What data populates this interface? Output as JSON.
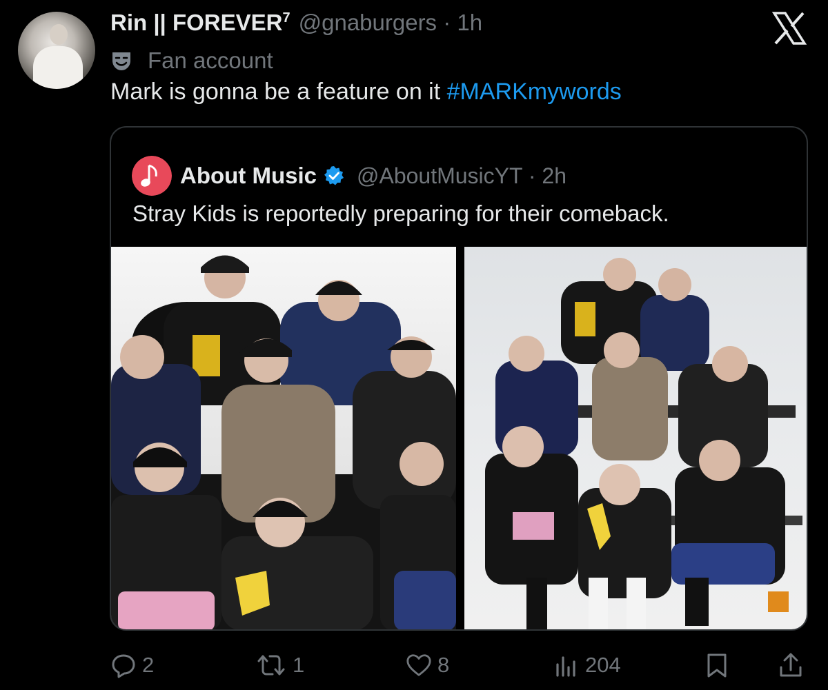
{
  "tweet": {
    "author_name": "Rin || FOREVER",
    "author_sup": "7",
    "handle": "@gnaburgers",
    "separator": "·",
    "time": "1h",
    "account_label": "Fan account",
    "text_prefix": "Mark is gonna be a feature on it ",
    "hashtag": "#MARKmywords",
    "icons": {
      "avatar": "user-avatar",
      "label": "theater-mask-icon",
      "brand": "x-logo-icon"
    }
  },
  "quote": {
    "author_name": "About Music",
    "handle": "@AboutMusicYT",
    "separator": "·",
    "time": "2h",
    "text": "Stray Kids is reportedly preparing for their comeback.",
    "icons": {
      "avatar": "music-note-avatar",
      "badge": "verified-badge-icon"
    },
    "colors": {
      "avatar_bg": "#e8495a",
      "verified": "#1d9bf0"
    }
  },
  "actions": {
    "reply_count": "2",
    "retweet_count": "1",
    "like_count": "8",
    "view_count": "204"
  },
  "colors": {
    "background": "#000000",
    "text": "#e7e9ea",
    "muted": "#71767b",
    "link": "#1d9bf0",
    "border": "#2f3336"
  }
}
